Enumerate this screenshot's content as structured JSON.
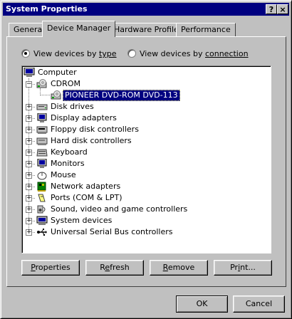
{
  "window": {
    "title": "System Properties",
    "help_glyph": "?",
    "close_glyph": "×"
  },
  "tabs": [
    {
      "label": "General",
      "active": false
    },
    {
      "label": "Device Manager",
      "active": true
    },
    {
      "label": "Hardware Profiles",
      "active": false
    },
    {
      "label": "Performance",
      "active": false
    }
  ],
  "view_options": [
    {
      "prefix": "View devices by ",
      "key": "type",
      "checked": true
    },
    {
      "prefix": "View devices by ",
      "key": "connection",
      "checked": false
    }
  ],
  "tree": {
    "root": "Computer",
    "items": [
      {
        "label": "CDROM",
        "expanded": true,
        "icon": "cdrom-icon"
      },
      {
        "label": "PIONEER DVD-ROM DVD-113",
        "child": true,
        "selected": true,
        "icon": "cdrom-icon"
      },
      {
        "label": "Disk drives",
        "icon": "disk-drive-icon"
      },
      {
        "label": "Display adapters",
        "icon": "monitor-icon"
      },
      {
        "label": "Floppy disk controllers",
        "icon": "floppy-controller-icon"
      },
      {
        "label": "Hard disk controllers",
        "icon": "hard-disk-controller-icon"
      },
      {
        "label": "Keyboard",
        "icon": "keyboard-icon"
      },
      {
        "label": "Monitors",
        "icon": "monitor-icon"
      },
      {
        "label": "Mouse",
        "icon": "mouse-icon"
      },
      {
        "label": "Network adapters",
        "icon": "network-adapter-icon"
      },
      {
        "label": "Ports (COM & LPT)",
        "icon": "port-icon"
      },
      {
        "label": "Sound, video and game controllers",
        "icon": "sound-icon"
      },
      {
        "label": "System devices",
        "icon": "system-devices-icon"
      },
      {
        "label": "Universal Serial Bus controllers",
        "icon": "usb-icon"
      }
    ]
  },
  "buttons": {
    "properties": {
      "pre": "",
      "key": "P",
      "post": "roperties"
    },
    "refresh": {
      "pre": "R",
      "key": "e",
      "post": "fresh"
    },
    "remove": {
      "pre": "",
      "key": "R",
      "post": "emove"
    },
    "print": {
      "pre": "Pr",
      "key": "i",
      "post": "nt..."
    },
    "ok": "OK",
    "cancel": "Cancel"
  }
}
